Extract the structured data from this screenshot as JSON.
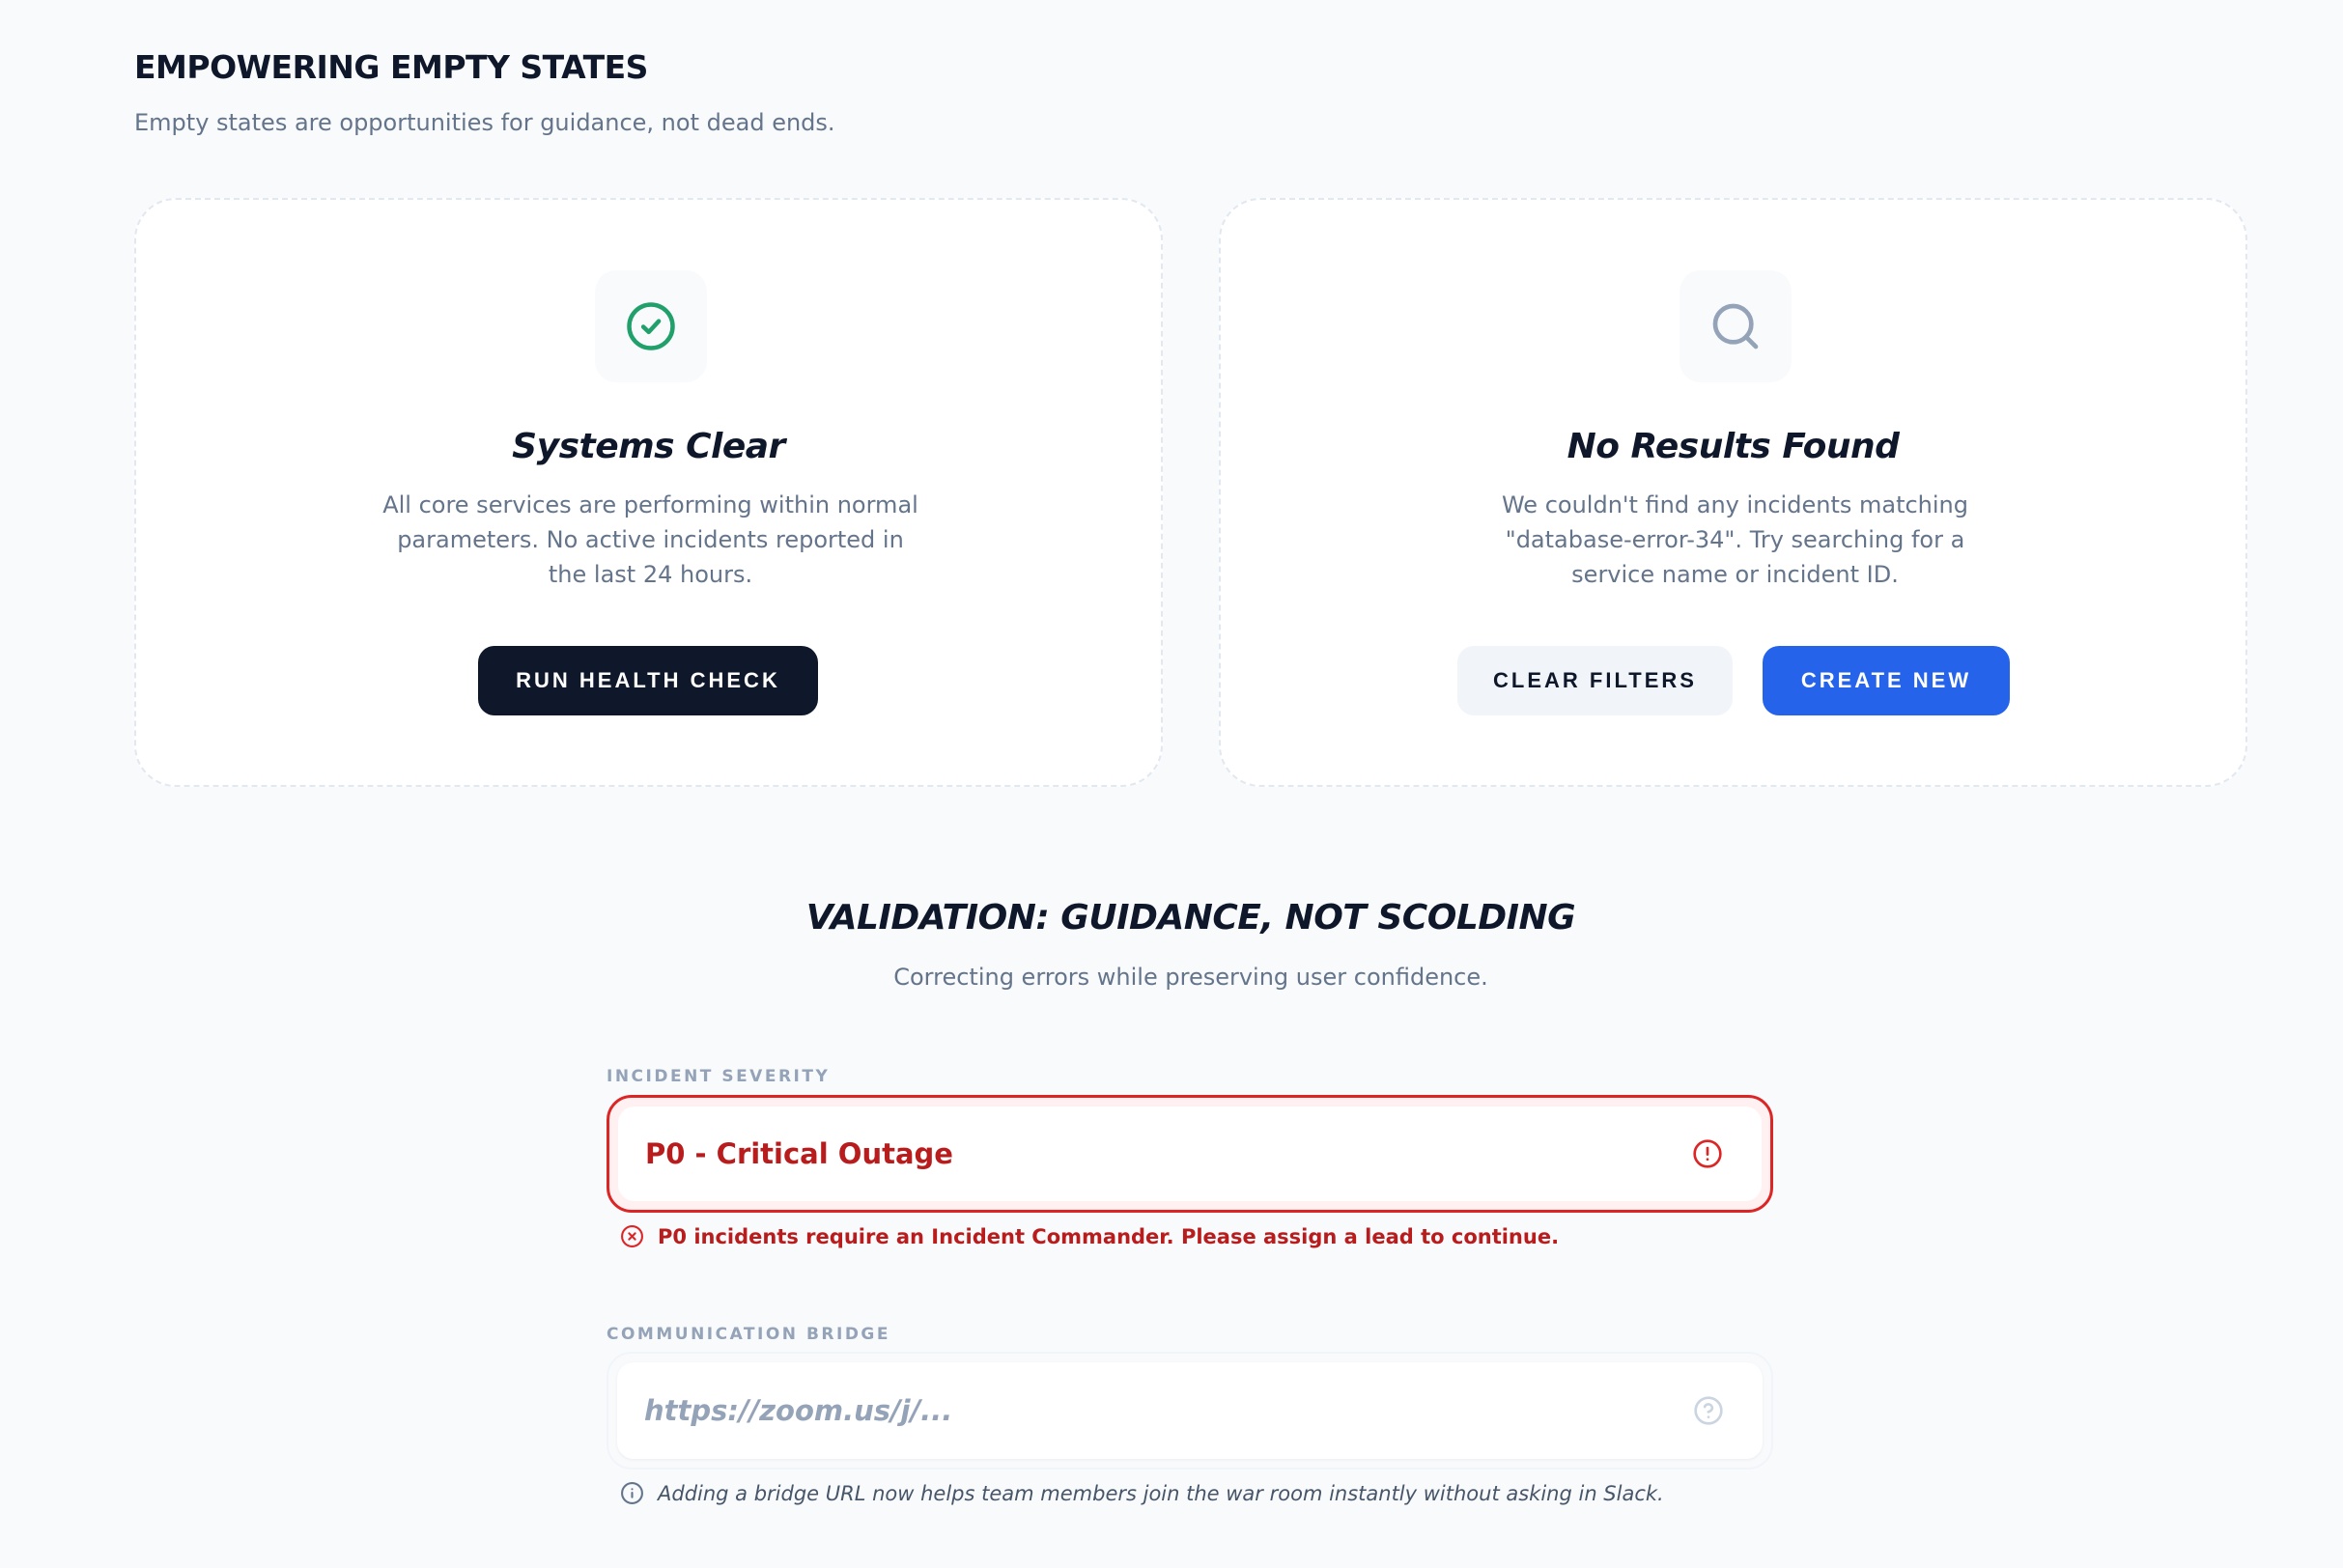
{
  "empty_states": {
    "title": "EMPOWERING EMPTY STATES",
    "subtitle": "Empty states are opportunities for guidance, not dead ends.",
    "systems_clear": {
      "icon": "check-circle-icon",
      "title": "Systems Clear",
      "description": "All core services are performing within normal parameters. No active incidents reported in the last 24 hours.",
      "button_label": "RUN HEALTH CHECK"
    },
    "no_results": {
      "icon": "search-icon",
      "title": "No Results Found",
      "description": "We couldn't find any incidents matching \"database-error-34\". Try searching for a service name or incident ID.",
      "clear_button_label": "CLEAR FILTERS",
      "create_button_label": "CREATE NEW"
    }
  },
  "validation": {
    "title": "VALIDATION: GUIDANCE, NOT SCOLDING",
    "subtitle": "Correcting errors while preserving user confidence.",
    "severity": {
      "label": "INCIDENT SEVERITY",
      "value": "P0 - Critical Outage",
      "error_message": "P0 incidents require an Incident Commander. Please assign a lead to continue.",
      "status_icon": "alert-circle-icon"
    },
    "bridge": {
      "label": "COMMUNICATION BRIDGE",
      "value": "",
      "placeholder": "https://zoom.us/j/...",
      "helper_message": "Adding a bridge URL now helps team members join the war room instantly without asking in Slack.",
      "status_icon": "help-circle-icon"
    }
  },
  "colors": {
    "background": "#f8fafc",
    "primary_dark": "#0f172a",
    "accent_blue": "#2563eb",
    "success_green": "#22a06b",
    "error_red": "#dc2626",
    "muted_text": "#64748b"
  }
}
